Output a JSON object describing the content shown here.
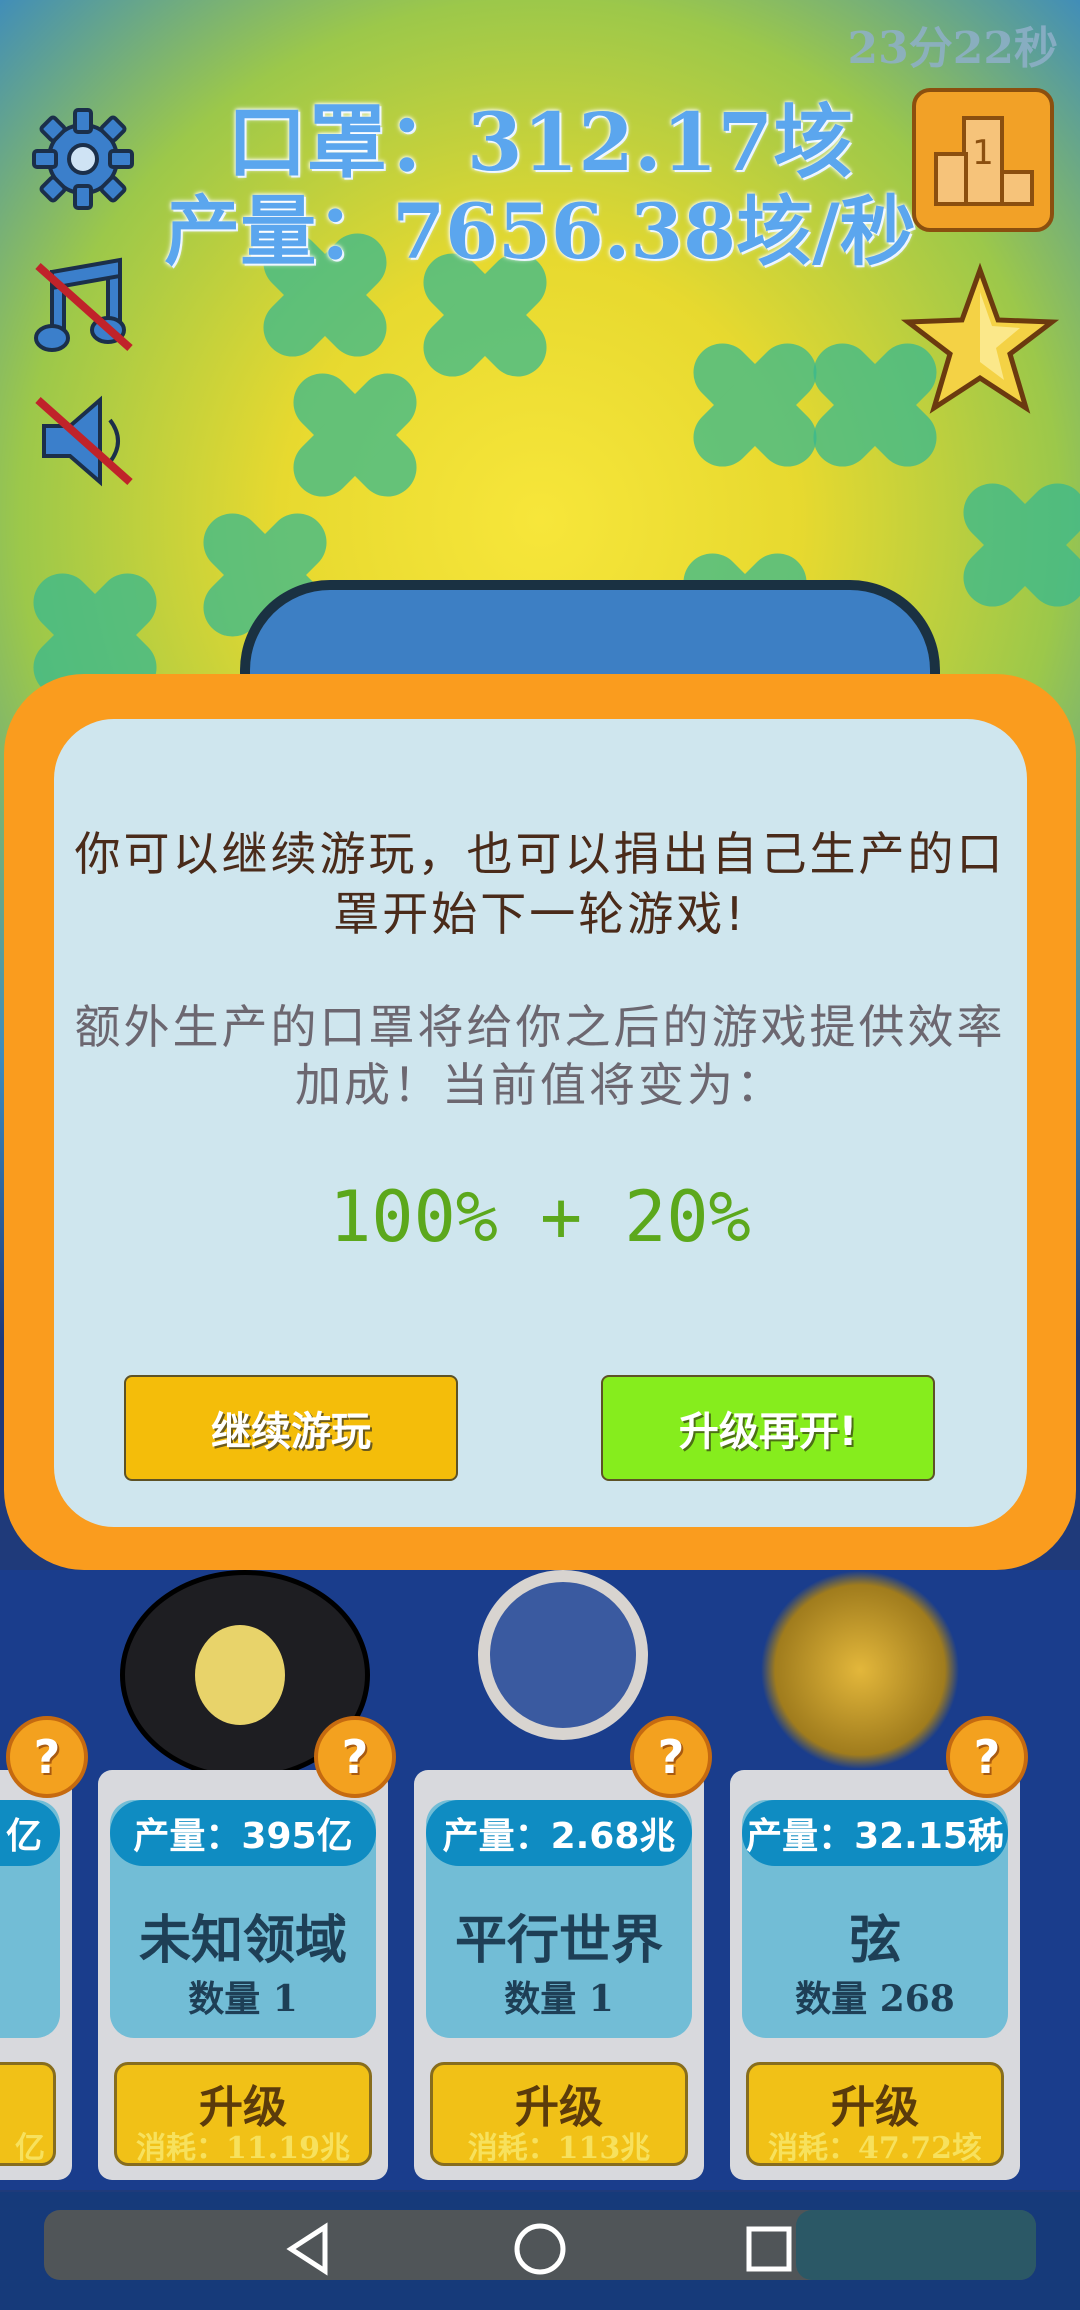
{
  "hud": {
    "timer": "23分22秒",
    "masks": "口罩：312.17垓",
    "production": "产量：7656.38垓/秒"
  },
  "side_icons": [
    "settings-gear-icon",
    "music-muted-icon",
    "sound-muted-icon",
    "leaderboard-icon",
    "star-icon"
  ],
  "leaderboard": {
    "rank_label": "1"
  },
  "dialog": {
    "message": "你可以继续游玩，也可以捐出自己生产的口罩开始下一轮游戏!",
    "bonus_message": "额外生产的口罩将给你之后的游戏提供效率加成！当前值将变为：",
    "bonus_value": "100% + 20%",
    "continue_label": "继续游玩",
    "prestige_label": "升级再开!"
  },
  "cards": [
    {
      "production": "亿",
      "cost": "亿"
    },
    {
      "production": "产量：395亿",
      "name": "未知领域",
      "count": "数量 1",
      "upgrade": "升级",
      "cost": "消耗：11.19兆"
    },
    {
      "production": "产量：2.68兆",
      "name": "平行世界",
      "count": "数量 1",
      "upgrade": "升级",
      "cost": "消耗：113兆"
    },
    {
      "production": "产量：32.15秭",
      "name": "弦",
      "count": "数量 268",
      "upgrade": "升级",
      "cost": "消耗：47.72垓"
    }
  ],
  "help_badge": "?",
  "colors": {
    "modal_border": "#fa9c1e",
    "modal_body": "#cfe6ee",
    "continue_button": "#f4bd0a",
    "prestige_button": "#86ed1d"
  }
}
